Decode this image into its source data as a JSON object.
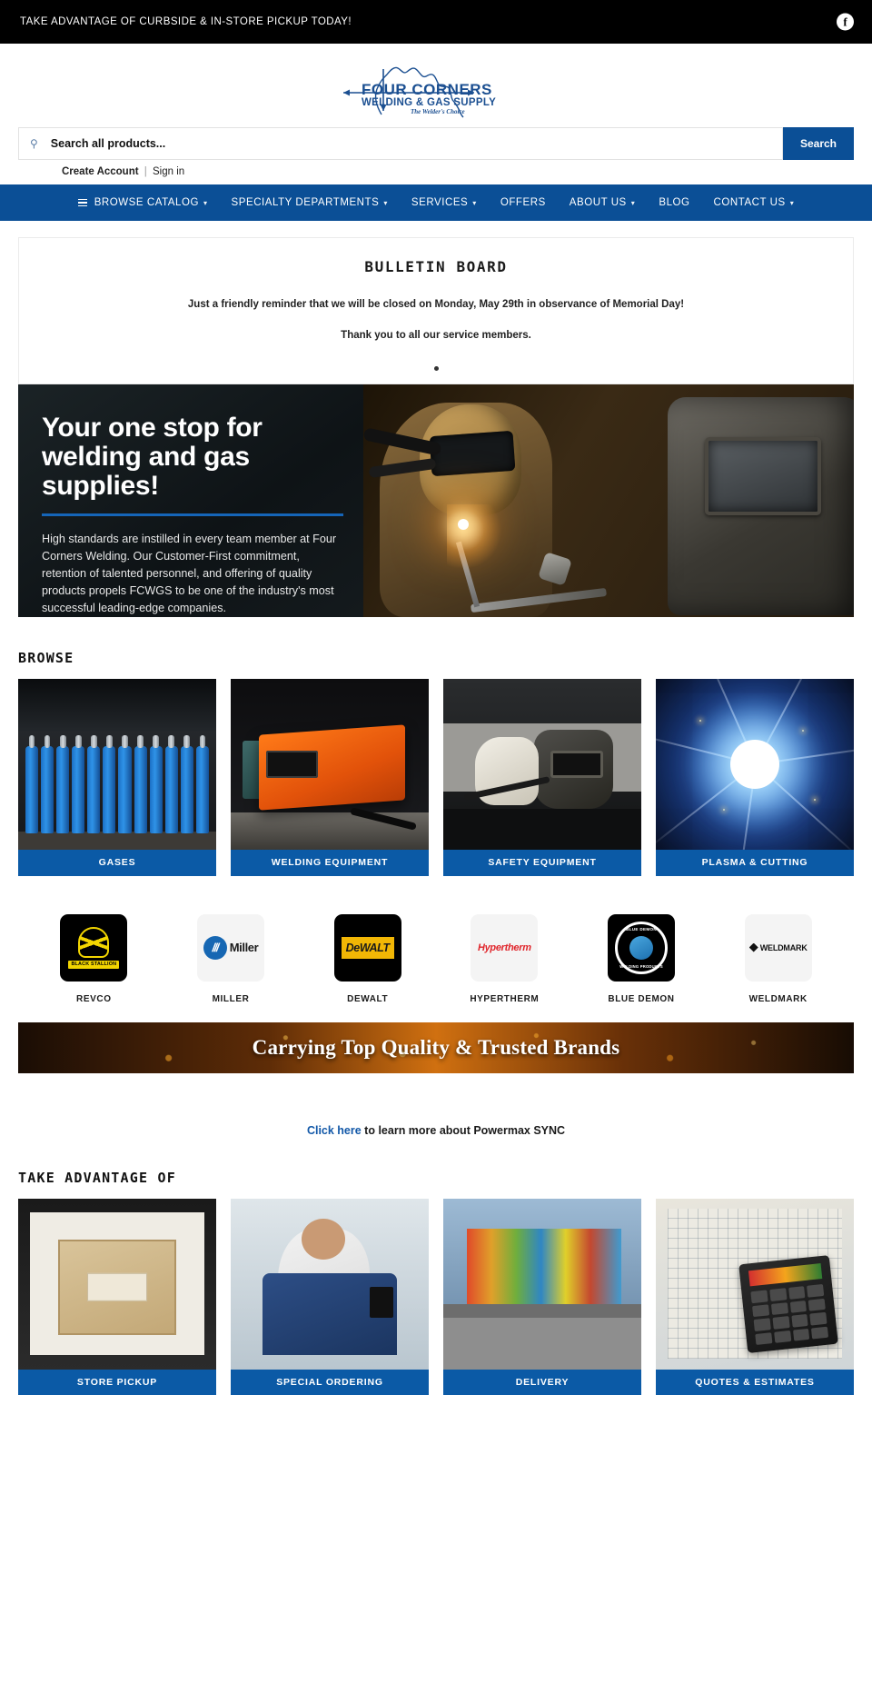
{
  "promo": {
    "text": "TAKE ADVANTAGE OF CURBSIDE & IN-STORE PICKUP TODAY!",
    "facebook_glyph": "f"
  },
  "logo": {
    "line1": "FOUR CORNERS",
    "line2": "WELDING & GAS SUPPLY",
    "tagline": "The Welder's Choice",
    "color": "#1b4f91"
  },
  "search": {
    "placeholder": "Search all products...",
    "value": "",
    "button_label": "Search",
    "icon": "search-icon"
  },
  "account": {
    "create_label": "Create Account",
    "separator": "|",
    "signin_label": "Sign in"
  },
  "nav": {
    "accent": "#0b4f96",
    "items": [
      {
        "label": "BROWSE CATALOG",
        "caret": "▾",
        "has_burger": true
      },
      {
        "label": "SPECIALTY DEPARTMENTS",
        "caret": "▾",
        "has_burger": false
      },
      {
        "label": "SERVICES",
        "caret": "▾",
        "has_burger": false
      },
      {
        "label": "OFFERS",
        "caret": "",
        "has_burger": false
      },
      {
        "label": "ABOUT US",
        "caret": "▾",
        "has_burger": false
      },
      {
        "label": "BLOG",
        "caret": "",
        "has_burger": false
      },
      {
        "label": "CONTACT US",
        "caret": "▾",
        "has_burger": false
      }
    ]
  },
  "bulletin": {
    "title": "BULLETIN BOARD",
    "line1": "Just a friendly reminder that we will be closed on Monday, May 29th in observance of Memorial Day!",
    "line2": "Thank you to all our service members."
  },
  "hero": {
    "heading": "Your one stop for welding and gas supplies!",
    "paragraph": "High standards are instilled in every team member at Four Corners Welding. Our Customer-First commitment, retention of talented personnel, and offering of quality products propels FCWGS to be one of the industry's most successful leading-edge companies.",
    "rule_color": "#1565b8"
  },
  "browse": {
    "heading": "BROWSE",
    "label_bg": "#0b5aa6",
    "tiles": [
      {
        "label": "GASES",
        "art": "gas"
      },
      {
        "label": "WELDING EQUIPMENT",
        "art": "weld"
      },
      {
        "label": "SAFETY EQUIPMENT",
        "art": "safety"
      },
      {
        "label": "PLASMA & CUTTING",
        "art": "plasma"
      }
    ]
  },
  "brands": [
    {
      "name": "REVCO",
      "logo_text": "BLACK STALLION",
      "style": "black"
    },
    {
      "name": "MILLER",
      "logo_text": "Miller",
      "style": "white"
    },
    {
      "name": "DEWALT",
      "logo_text": "DeWALT",
      "style": "black"
    },
    {
      "name": "HYPERTHERM",
      "logo_text": "Hypertherm",
      "style": "white"
    },
    {
      "name": "BLUE DEMON",
      "logo_text": "BLUE DEMON WELDING PRODUCTS",
      "style": "black"
    },
    {
      "name": "WELDMARK",
      "logo_text": "WELDMARK",
      "style": "white"
    }
  ],
  "brand_banner": {
    "text": "Carrying Top Quality & Trusted Brands"
  },
  "sync": {
    "link_text": "Click here",
    "rest_text": " to learn more about Powermax SYNC"
  },
  "advantage": {
    "heading": "TAKE ADVANTAGE OF",
    "tiles": [
      {
        "label": "STORE PICKUP",
        "art": "pickup"
      },
      {
        "label": "SPECIAL ORDERING",
        "art": "special"
      },
      {
        "label": "DELIVERY",
        "art": "delivery"
      },
      {
        "label": "QUOTES & ESTIMATES",
        "art": "quotes"
      }
    ]
  }
}
